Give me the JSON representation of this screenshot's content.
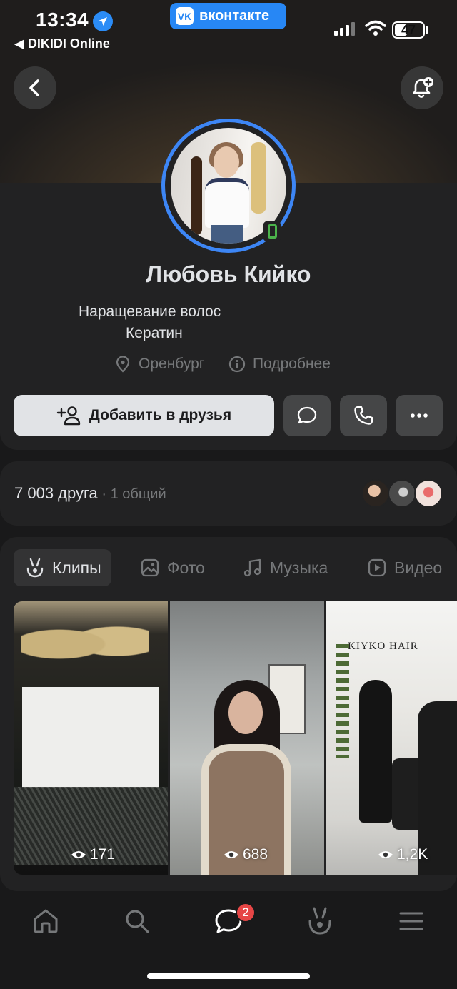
{
  "status_bar": {
    "time": "13:34",
    "back_app": "◀ DIKIDI Online",
    "vk_pill": "вконтакте",
    "vk_logo": "VK",
    "battery": "47"
  },
  "profile": {
    "name": "Любовь Кийко",
    "status_line_1": "Наращевание волос",
    "status_line_2": "Кератин",
    "city": "Оренбург",
    "details": "Подробнее",
    "add_friend_label": "Добавить в друзья"
  },
  "friends": {
    "count": "7 003 друга",
    "separator": " · ",
    "common": "1 общий"
  },
  "tabs": [
    {
      "label": "Клипы",
      "active": true
    },
    {
      "label": "Фото",
      "active": false
    },
    {
      "label": "Музыка",
      "active": false
    },
    {
      "label": "Видео",
      "active": false
    }
  ],
  "clips": [
    {
      "views": "171"
    },
    {
      "views": "688"
    },
    {
      "views": "1,2K",
      "sign": "KIYKO HAIR"
    }
  ],
  "tabbar": {
    "messages_badge": "2"
  },
  "colors": {
    "accent": "#2787f5",
    "avatar_ring": "#3d86f5",
    "online": "#4bb34b",
    "badge": "#e64646",
    "background": "#19191a",
    "card": "#222223"
  },
  "icons": [
    "location-arrow-icon",
    "signal-icon",
    "wifi-icon",
    "battery-icon",
    "back-icon",
    "bell-plus-icon",
    "map-pin-icon",
    "info-icon",
    "add-user-icon",
    "message-icon",
    "phone-icon",
    "more-icon",
    "clips-icon",
    "photo-icon",
    "music-icon",
    "video-icon",
    "eye-icon",
    "home-icon",
    "search-icon",
    "messages-icon",
    "menu-icon"
  ]
}
